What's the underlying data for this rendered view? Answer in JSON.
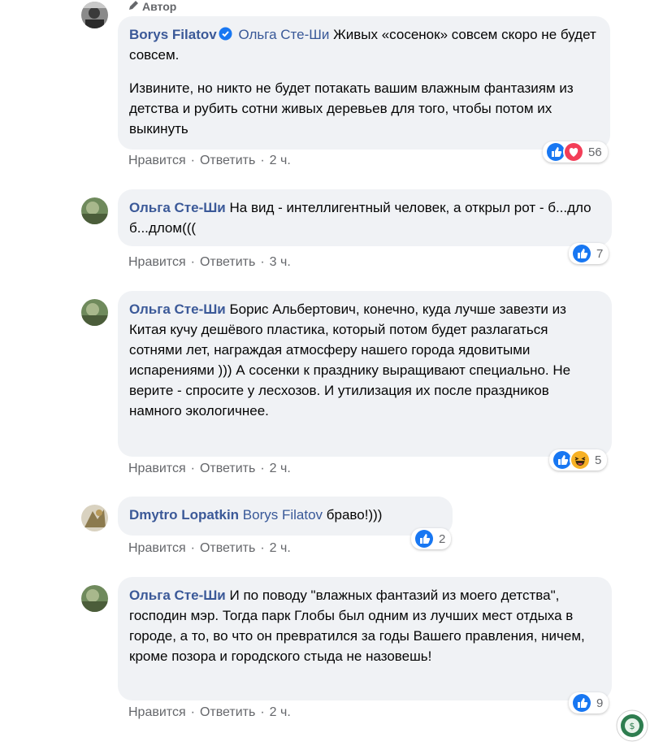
{
  "comments": [
    {
      "author": "Borys Filatov",
      "author_badge": "Автор",
      "verified": true,
      "mention": "Ольга Сте-Ши",
      "paragraphs": [
        "Живых «сосенок» совсем скоро не будет совсем.",
        "Извините, но никто не будет потакать вашим влажным фантазиям из детства и рубить сотни живых деревьев для того, чтобы потом их выкинуть"
      ],
      "like_label": "Нравится",
      "reply_label": "Ответить",
      "time": "2 ч.",
      "reaction_count": "56",
      "reactions": [
        "like-icon",
        "love-icon"
      ]
    },
    {
      "author": "Ольга Сте-Ши",
      "paragraphs": [
        "На вид - интеллигентный человек, а открыл рот - б...дло б...длом((("
      ],
      "like_label": "Нравится",
      "reply_label": "Ответить",
      "time": "3 ч.",
      "reaction_count": "7",
      "reactions": [
        "like-icon"
      ]
    },
    {
      "author": "Ольга Сте-Ши",
      "paragraphs": [
        "Борис Альбертович, конечно, куда лучше завезти из Китая кучу дешёвого пластика, который потом будет разлагаться сотнями лет, награждая атмосферу нашего города ядовитыми испарениями ))) А сосенки к празднику выращивают специально. Не верите - спросите у лесхозов. И утилизация их после праздников намного экологичнее."
      ],
      "like_label": "Нравится",
      "reply_label": "Ответить",
      "time": "2 ч.",
      "reaction_count": "5",
      "reactions": [
        "like-icon",
        "haha-icon"
      ]
    },
    {
      "author": "Dmytro Lopatkin",
      "mention": "Borys Filatov",
      "paragraphs": [
        "браво!)))"
      ],
      "like_label": "Нравится",
      "reply_label": "Ответить",
      "time": "2 ч.",
      "reaction_count": "2",
      "reactions": [
        "like-icon"
      ]
    },
    {
      "author": "Ольга Сте-Ши",
      "paragraphs": [
        "И по поводу \"влажных фантазий из моего детства\", господин мэр. Тогда парк Глобы был одним из лучших мест отдыха в городе, а то, во что он превратился за годы Вашего правления, ничем, кроме позора и городского стыда не назовешь!"
      ],
      "like_label": "Нравится",
      "reply_label": "Ответить",
      "time": "2 ч.",
      "reaction_count": "9",
      "reactions": [
        "like-icon"
      ]
    }
  ],
  "separator": "·",
  "colors": {
    "bubble": "#f0f2f5",
    "author": "#3b5998",
    "meta": "#65676b",
    "like": "#1877f2",
    "love": "#f33e58",
    "haha": "#f7b125"
  }
}
